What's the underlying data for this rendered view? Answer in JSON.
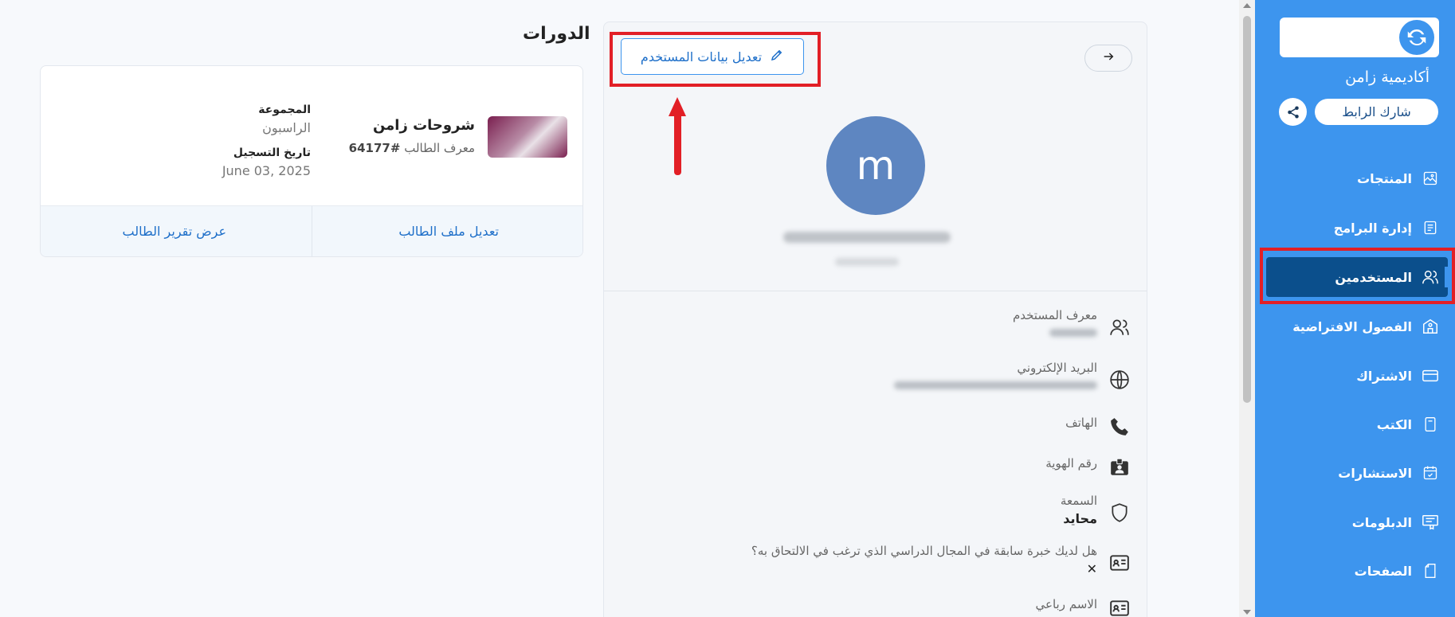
{
  "sidebar": {
    "academy_name": "أكاديمية زامن",
    "share_label": "شارك الرابط",
    "items": [
      {
        "label": "المنتجات",
        "icon": "image-icon"
      },
      {
        "label": "إدارة البرامج",
        "icon": "document-list-icon"
      },
      {
        "label": "المستخدمين",
        "icon": "users-icon",
        "active": true
      },
      {
        "label": "الفصول الافتراضية",
        "icon": "classroom-icon"
      },
      {
        "label": "الاشتراك",
        "icon": "card-icon"
      },
      {
        "label": "الكتب",
        "icon": "book-icon"
      },
      {
        "label": "الاستشارات",
        "icon": "calendar-check-icon"
      },
      {
        "label": "الدبلومات",
        "icon": "certificate-icon"
      },
      {
        "label": "الصفحات",
        "icon": "page-icon"
      }
    ]
  },
  "profile": {
    "edit_label": "تعديل بيانات المستخدم",
    "avatar_letter": "m",
    "fields": {
      "user_id_label": "معرف المستخدم",
      "email_label": "البريد الإلكتروني",
      "phone_label": "الهاتف",
      "id_number_label": "رقم الهوية",
      "reputation_label": "السمعة",
      "reputation_value": "محايد",
      "experience_label": "هل لديك خبرة سابقة في المجال الدراسي الذي ترغب في الالتحاق به؟",
      "experience_value": "✕",
      "full_name_label": "الاسم رباعي"
    }
  },
  "courses": {
    "title": "الدورات",
    "card": {
      "name": "شروحات زامن",
      "student_id_label": "معرف الطالب",
      "student_id_value": "#64177",
      "group_label": "المجموعة",
      "group_value": "الراسبون",
      "date_label": "تاريخ التسجيل",
      "date_value": "June 03, 2025",
      "edit_profile_label": "تعديل ملف الطالب",
      "view_report_label": "عرض تقرير الطالب"
    }
  },
  "colors": {
    "sidebar": "#3d95ee",
    "active": "#0b4f8c",
    "highlight": "#e21f26",
    "accent": "#1e6fc9"
  }
}
